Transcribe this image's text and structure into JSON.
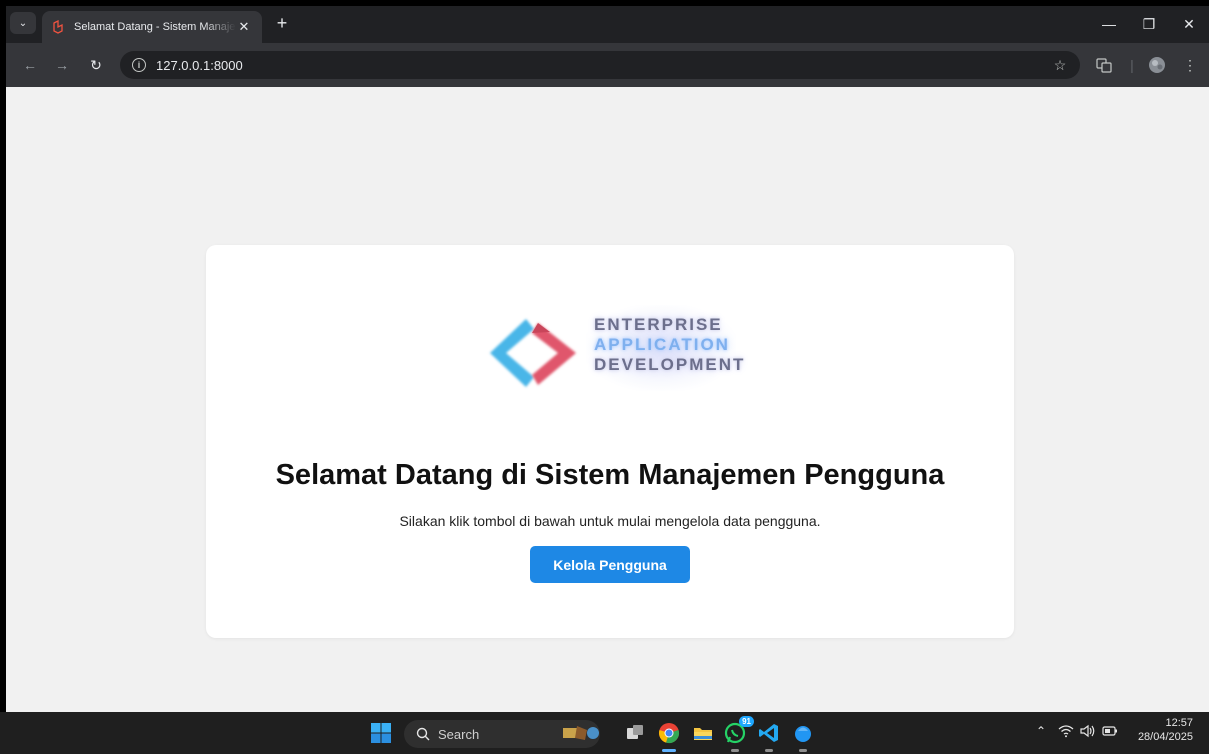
{
  "browser": {
    "tab_title": "Selamat Datang - Sistem Manajemen Pengguna",
    "url": "127.0.0.1:8000"
  },
  "page": {
    "logo_lines": [
      "ENTERPRISE",
      "APPLICATION",
      "DEVELOPMENT"
    ],
    "heading": "Selamat Datang di Sistem Manajemen Pengguna",
    "subtext": "Silakan klik tombol di bawah untuk mulai mengelola data pengguna.",
    "button_label": "Kelola Pengguna",
    "button_color": "#1e88e5"
  },
  "taskbar": {
    "search_label": "Search",
    "whatsapp_badge": "91",
    "time": "12:57",
    "date": "28/04/2025"
  },
  "colors": {
    "page_bg": "#f1f1f1",
    "card_bg": "#ffffff",
    "chrome_dark": "#202124",
    "chrome_toolbar": "#35363a"
  }
}
